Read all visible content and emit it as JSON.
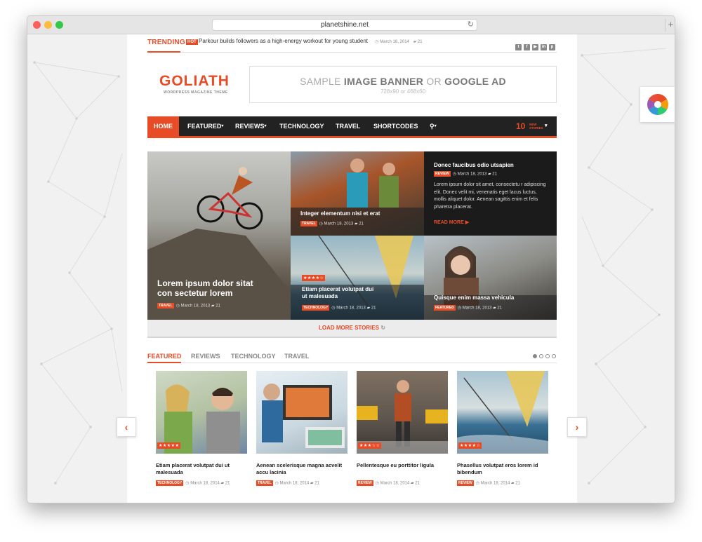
{
  "browser": {
    "url": "planetshine.net"
  },
  "trending": {
    "label": "TRENDING",
    "hot": "HOT",
    "title": "Parkour builds followers as a high-energy workout for young student",
    "date": "March 18, 2014",
    "comments": "21"
  },
  "socials": [
    "twitter-icon",
    "facebook-icon",
    "youtube-icon",
    "linkedin-icon",
    "pinterest-icon"
  ],
  "logo": {
    "name": "GOLIATH",
    "tagline": "WORDPRESS MAGAZINE THEME"
  },
  "banner": {
    "part1": "SAMPLE ",
    "part2": "IMAGE BANNER",
    "part3": " OR ",
    "part4": "GOOGLE AD",
    "sub": "728x90 or 468x60"
  },
  "menu": {
    "items": [
      "HOME",
      "FEATURED",
      "REVIEWS",
      "TECHNOLOGY",
      "TRAVEL",
      "SHORTCODES"
    ],
    "new_count": "10",
    "new_label_1": "NEW",
    "new_label_2": "STORIES"
  },
  "grid": {
    "main": {
      "title_1": "Lorem ipsum dolor sitat",
      "title_2": "con sectetur lorem",
      "tag": "TRAVEL",
      "date": "March 18, 2013",
      "comments": "21"
    },
    "hikers": {
      "title": "Integer elementum nisi et erat",
      "tag": "TRAVEL",
      "date": "March 18, 2013",
      "comments": "21"
    },
    "text": {
      "title": "Donec faucibus odio utsapien",
      "tag": "REVIEW",
      "date": "March 18, 2013",
      "comments": "21",
      "body": "Lorem ipsum dolor sit amet, consectetu r adipiscing elit. Donec velit mi, venenatis eget lacus luctus, mollis aliquet dolor. Aenean sagittis enim et felis pharetra placerat.",
      "read_more": "READ MORE"
    },
    "sail": {
      "title_1": "Etiam placerat volutpat dui",
      "title_2": "ut malesuada",
      "tag": "TECHNOLOGY",
      "date": "March 18, 2013",
      "comments": "21",
      "stars": "★★★★☆"
    },
    "woman": {
      "title": "Quisque enim massa vehicula",
      "tag": "FEATURED",
      "date": "March 18, 2013",
      "comments": "21"
    }
  },
  "load_more": "LOAD MORE STORIES",
  "tabs": [
    "FEATURED",
    "REVIEWS",
    "TECHNOLOGY",
    "TRAVEL"
  ],
  "cards": [
    {
      "title": "Etiam placerat volutpat dui ut malesuada",
      "tag": "TECHNOLOGY",
      "date": "March 18, 2014",
      "comments": "21",
      "stars": "★★★★★"
    },
    {
      "title": "Aenean scelerisque magna acvelit accu lacinia",
      "tag": "TRAVEL",
      "date": "March 18, 2014",
      "comments": "21",
      "stars": ""
    },
    {
      "title": "Pellentesque eu porttitor ligula",
      "tag": "REVIEW",
      "date": "March 18, 2014",
      "comments": "21",
      "stars": "★★★☆☆"
    },
    {
      "title": "Phasellus volutpat eros lorem id bibendum",
      "tag": "REVIEW",
      "date": "March 18, 2014",
      "comments": "21",
      "stars": "★★★★☆"
    }
  ],
  "colors": {
    "accent": "#e84c27",
    "menu_bg": "#222222"
  }
}
